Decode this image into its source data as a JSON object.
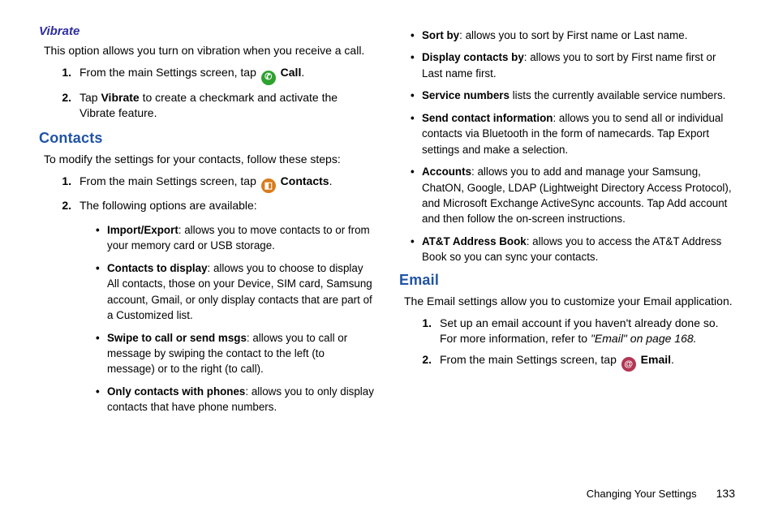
{
  "vibrate": {
    "heading": "Vibrate",
    "intro": "This option allows you turn on vibration when you receive a call.",
    "steps": [
      {
        "num": "1.",
        "pre": "From the main Settings screen, tap ",
        "icon": "phone-icon",
        "post": "Call",
        "suffix": "."
      },
      {
        "num": "2.",
        "text_pre": "Tap ",
        "bold": "Vibrate",
        "text_post": " to create a checkmark and activate the Vibrate feature."
      }
    ]
  },
  "contacts": {
    "heading": "Contacts",
    "intro": "To modify the settings for your contacts, follow these steps:",
    "steps": [
      {
        "num": "1.",
        "pre": "From the main Settings screen, tap ",
        "icon": "contacts-icon",
        "post": "Contacts",
        "suffix": "."
      },
      {
        "num": "2.",
        "text": "The following options are available:"
      }
    ],
    "options_left": [
      {
        "term": "Import/Export",
        "desc": ": allows you to move contacts to or from your memory card or USB storage."
      },
      {
        "term": "Contacts to display",
        "desc": ": allows you to choose to display All contacts, those on your Device, SIM card, Samsung account, Gmail, or only display contacts that are part of a Customized list."
      },
      {
        "term": "Swipe to call or send msgs",
        "desc": ": allows you to call or message by swiping the contact to the left (to message) or to the right (to call)."
      },
      {
        "term": "Only contacts with phones",
        "desc": ": allows you to only display contacts that have phone numbers."
      }
    ],
    "options_right": [
      {
        "term": "Sort by",
        "desc": ": allows you to sort by First name or Last name."
      },
      {
        "term": "Display contacts by",
        "desc": ": allows you to sort by First name first or Last name first."
      },
      {
        "term": "Service numbers",
        "desc": " lists the currently available service numbers."
      },
      {
        "term": "Send contact information",
        "desc": ": allows you to send all or individual contacts via Bluetooth in the form of namecards. Tap Export settings and make a selection."
      },
      {
        "term": "Accounts",
        "desc": ": allows you to add and manage your Samsung, ChatON, Google, LDAP (Lightweight Directory Access Protocol), and Microsoft Exchange ActiveSync accounts. Tap Add account and then follow the on-screen instructions."
      },
      {
        "term": "AT&T Address Book",
        "desc": ": allows you to access the AT&T Address Book so you can sync your contacts."
      }
    ]
  },
  "email": {
    "heading": "Email",
    "intro": "The Email settings allow you to customize your Email application.",
    "steps": [
      {
        "num": "1.",
        "text": "Set up an email account if you haven't already done so. For more information, refer to ",
        "iref": "\"Email\"  on page 168."
      },
      {
        "num": "2.",
        "pre": "From the main Settings screen, tap ",
        "icon": "email-icon",
        "post": "Email",
        "suffix": "."
      }
    ]
  },
  "footer": {
    "section": "Changing Your Settings",
    "page": "133"
  },
  "icons": {
    "phone-icon": "✆",
    "contacts-icon": "◧",
    "email-icon": "@"
  }
}
